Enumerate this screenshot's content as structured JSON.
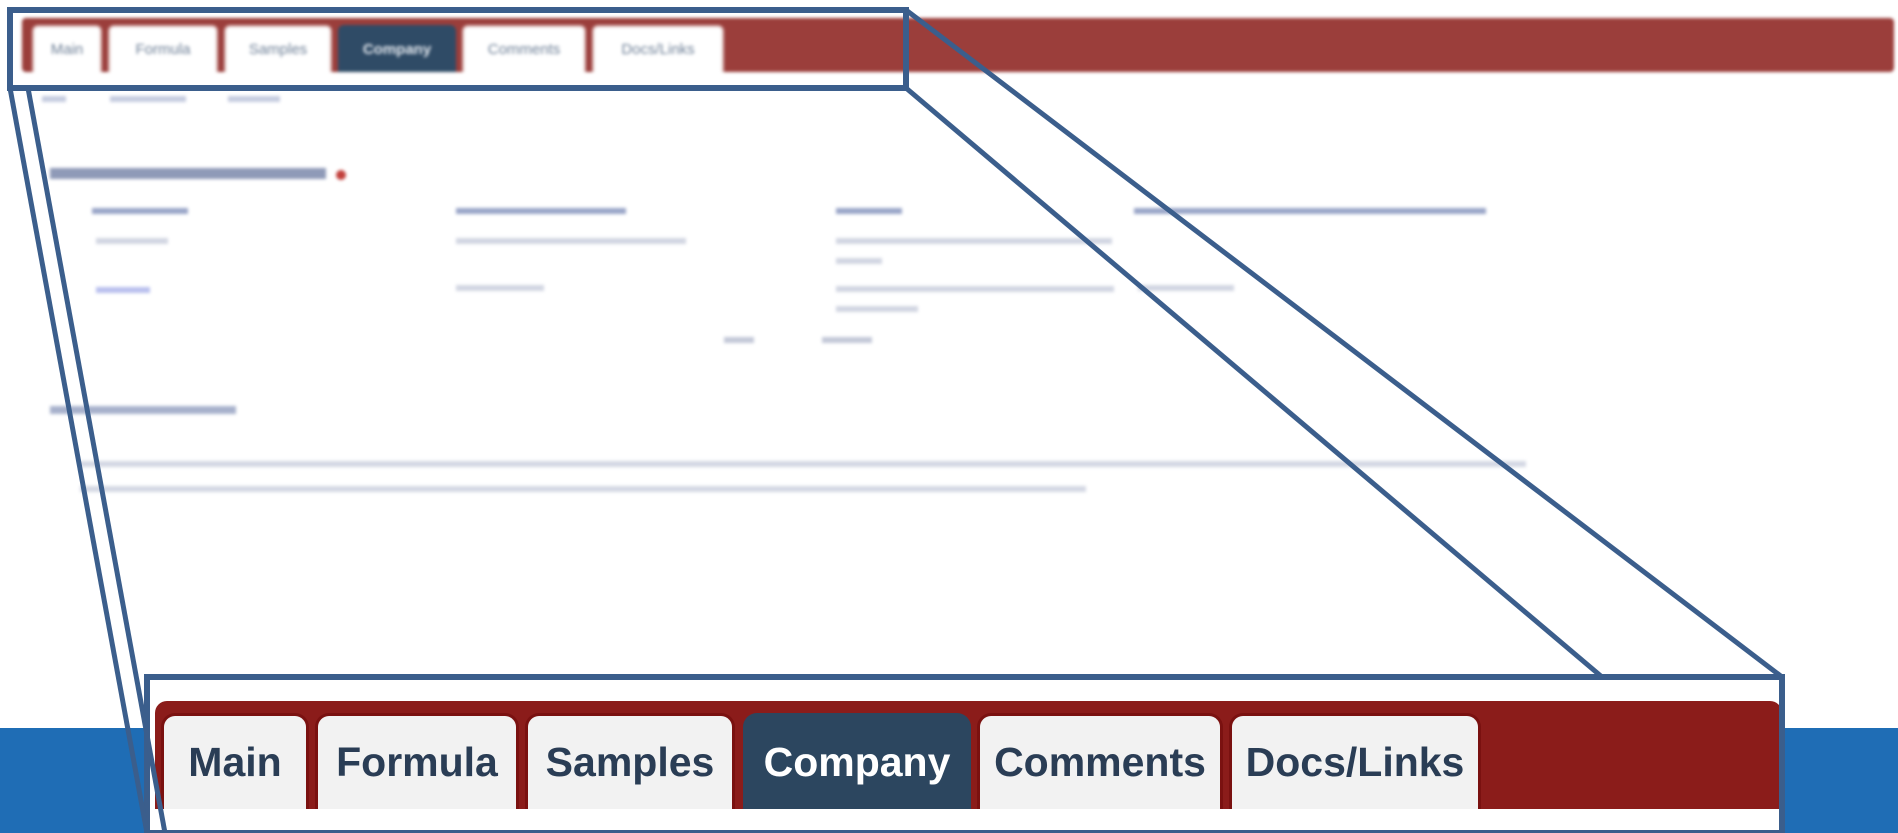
{
  "tabs": [
    {
      "label": "Main",
      "active": false
    },
    {
      "label": "Formula",
      "active": false
    },
    {
      "label": "Samples",
      "active": false
    },
    {
      "label": "Company",
      "active": true
    },
    {
      "label": "Comments",
      "active": false
    },
    {
      "label": "Docs/Links",
      "active": false
    }
  ],
  "colors": {
    "tab_bar": "#8b1c1a",
    "active_tab": "#2c465f",
    "inactive_tab": "#f2f2f2",
    "tab_text": "#2a3d55",
    "callout": "#3b5e8c",
    "bottom_band": "#1f6db5"
  }
}
